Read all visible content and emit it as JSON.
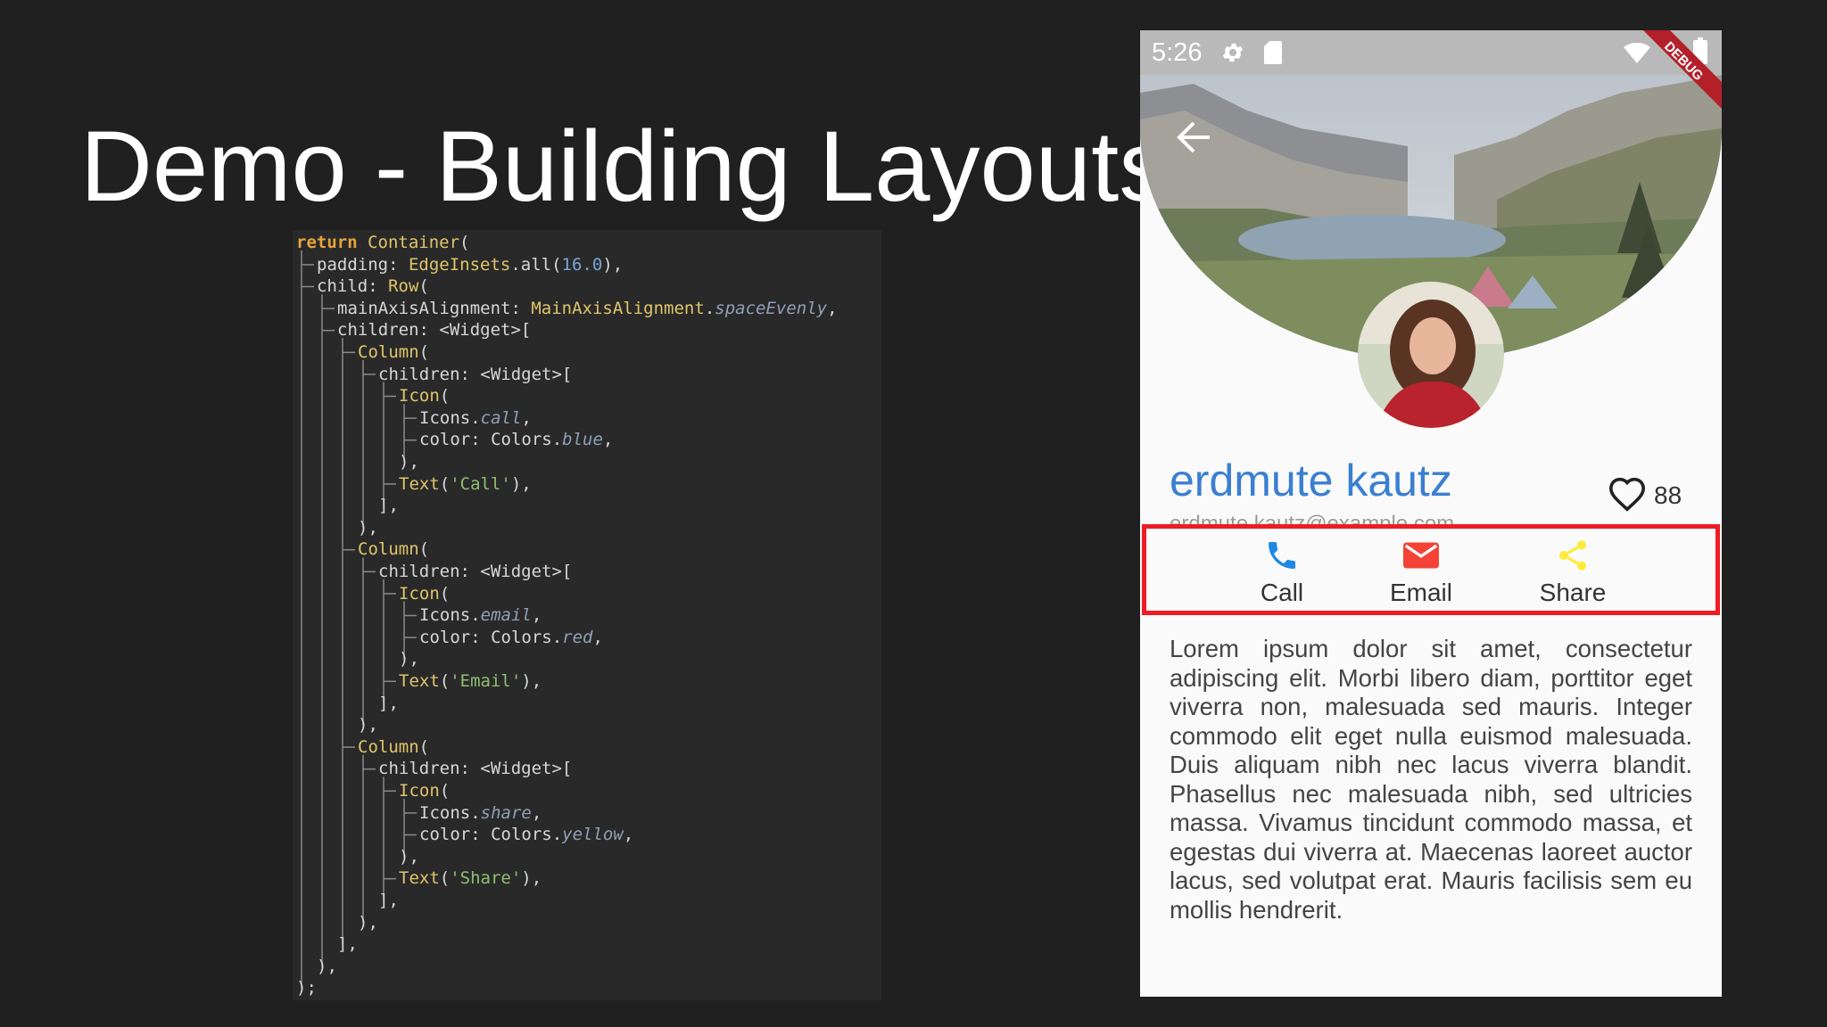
{
  "slide": {
    "title": "Demo - Building Layouts"
  },
  "code": {
    "lines": [
      [
        [
          "kw",
          "return"
        ],
        [
          "p",
          " "
        ],
        [
          "cls",
          "Container"
        ],
        [
          "p",
          "("
        ]
      ],
      [
        [
          "p",
          "padding: "
        ],
        [
          "cls",
          "EdgeInsets"
        ],
        [
          "p",
          ".all("
        ],
        [
          "num",
          "16.0"
        ],
        [
          "p",
          "),"
        ]
      ],
      [
        [
          "p",
          "child: "
        ],
        [
          "cls",
          "Row"
        ],
        [
          "p",
          "("
        ]
      ],
      [
        [
          "p",
          "mainAxisAlignment: "
        ],
        [
          "cls",
          "MainAxisAlignment"
        ],
        [
          "p",
          "."
        ],
        [
          "en",
          "spaceEvenly"
        ],
        [
          "p",
          ","
        ]
      ],
      [
        [
          "p",
          "children: <Widget>["
        ]
      ],
      [
        [
          "cls",
          "Column"
        ],
        [
          "p",
          "("
        ]
      ],
      [
        [
          "p",
          "children: <Widget>["
        ]
      ],
      [
        [
          "cls",
          "Icon"
        ],
        [
          "p",
          "("
        ]
      ],
      [
        [
          "p",
          "Icons."
        ],
        [
          "en",
          "call"
        ],
        [
          "p",
          ","
        ]
      ],
      [
        [
          "p",
          "color: Colors."
        ],
        [
          "en",
          "blue"
        ],
        [
          "p",
          ","
        ]
      ],
      [
        [
          "p",
          "),"
        ]
      ],
      [
        [
          "cls",
          "Text"
        ],
        [
          "p",
          "("
        ],
        [
          "str",
          "'Call'"
        ],
        [
          "p",
          "),"
        ]
      ],
      [
        [
          "p",
          "],"
        ]
      ],
      [
        [
          "p",
          "),"
        ]
      ],
      [
        [
          "cls",
          "Column"
        ],
        [
          "p",
          "("
        ]
      ],
      [
        [
          "p",
          "children: <Widget>["
        ]
      ],
      [
        [
          "cls",
          "Icon"
        ],
        [
          "p",
          "("
        ]
      ],
      [
        [
          "p",
          "Icons."
        ],
        [
          "en",
          "email"
        ],
        [
          "p",
          ","
        ]
      ],
      [
        [
          "p",
          "color: Colors."
        ],
        [
          "en",
          "red"
        ],
        [
          "p",
          ","
        ]
      ],
      [
        [
          "p",
          "),"
        ]
      ],
      [
        [
          "cls",
          "Text"
        ],
        [
          "p",
          "("
        ],
        [
          "str",
          "'Email'"
        ],
        [
          "p",
          "),"
        ]
      ],
      [
        [
          "p",
          "],"
        ]
      ],
      [
        [
          "p",
          "),"
        ]
      ],
      [
        [
          "cls",
          "Column"
        ],
        [
          "p",
          "("
        ]
      ],
      [
        [
          "p",
          "children: <Widget>["
        ]
      ],
      [
        [
          "cls",
          "Icon"
        ],
        [
          "p",
          "("
        ]
      ],
      [
        [
          "p",
          "Icons."
        ],
        [
          "en",
          "share"
        ],
        [
          "p",
          ","
        ]
      ],
      [
        [
          "p",
          "color: Colors."
        ],
        [
          "en",
          "yellow"
        ],
        [
          "p",
          ","
        ]
      ],
      [
        [
          "p",
          "),"
        ]
      ],
      [
        [
          "cls",
          "Text"
        ],
        [
          "p",
          "("
        ],
        [
          "str",
          "'Share'"
        ],
        [
          "p",
          "),"
        ]
      ],
      [
        [
          "p",
          "],"
        ]
      ],
      [
        [
          "p",
          "),"
        ]
      ],
      [
        [
          "p",
          "],"
        ]
      ],
      [
        [
          "p",
          "),"
        ]
      ],
      [
        [
          "p",
          ");"
        ]
      ]
    ]
  },
  "phone": {
    "status": {
      "time": "5:26",
      "debug_label": "DEBUG"
    },
    "profile": {
      "name": "erdmute kautz",
      "email": "erdmute.kautz@example.com",
      "likes": "88"
    },
    "actions": [
      {
        "label": "Call",
        "icon": "call-icon",
        "color": "#1e88e5"
      },
      {
        "label": "Email",
        "icon": "email-icon",
        "color": "#f44336"
      },
      {
        "label": "Share",
        "icon": "share-icon",
        "color": "#ffeb3b"
      }
    ],
    "body_text": "Lorem ipsum dolor sit amet, consectetur adipiscing elit. Morbi libero diam, porttitor eget viverra non, malesuada sed mauris. Integer commodo elit eget nulla euismod malesuada. Duis aliquam nibh nec lacus viverra blandit. Phasellus nec malesuada nibh, sed ultricies massa. Vivamus tincidunt commodo massa, et egestas dui viverra at. Maecenas laoreet auctor lacus, sed volutpat erat. Mauris facilisis sem eu mollis hendrerit."
  }
}
